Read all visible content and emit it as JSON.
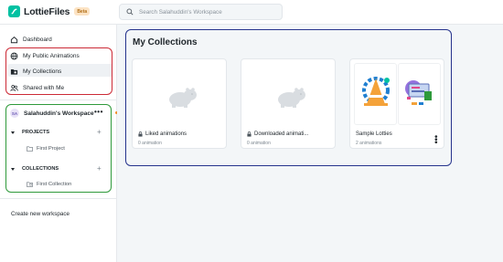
{
  "brand": {
    "name": "LottieFiles",
    "badge": "Beta",
    "accent": "#00c1a2"
  },
  "search": {
    "placeholder": "Search Salahuddin's Workspace"
  },
  "sidebar": {
    "items": [
      {
        "label": "Dashboard",
        "icon": "home-icon"
      },
      {
        "label": "My Public Animations",
        "icon": "globe-icon"
      },
      {
        "label": "My Collections",
        "icon": "collection-icon",
        "active": true
      },
      {
        "label": "Shared with Me",
        "icon": "users-icon"
      }
    ],
    "workspace": {
      "avatar": "SA",
      "name": "Salahuddin's Workspace",
      "projects_label": "PROJECTS",
      "projects": [
        "First Project"
      ],
      "collections_label": "COLLECTIONS",
      "collections": [
        "First Collection"
      ]
    },
    "create_workspace": "Create new workspace"
  },
  "main": {
    "title": "My Collections",
    "cards": [
      {
        "title": "Liked animations",
        "subtitle": "0 animation",
        "locked": true
      },
      {
        "title": "Downloaded animati...",
        "subtitle": "0 animation",
        "locked": true
      },
      {
        "title": "Sample Lotties",
        "subtitle": "2 animations",
        "locked": false
      }
    ]
  },
  "highlight_colors": {
    "red": "#cc2a36",
    "green": "#2f9a3b",
    "blue": "#26348d"
  }
}
